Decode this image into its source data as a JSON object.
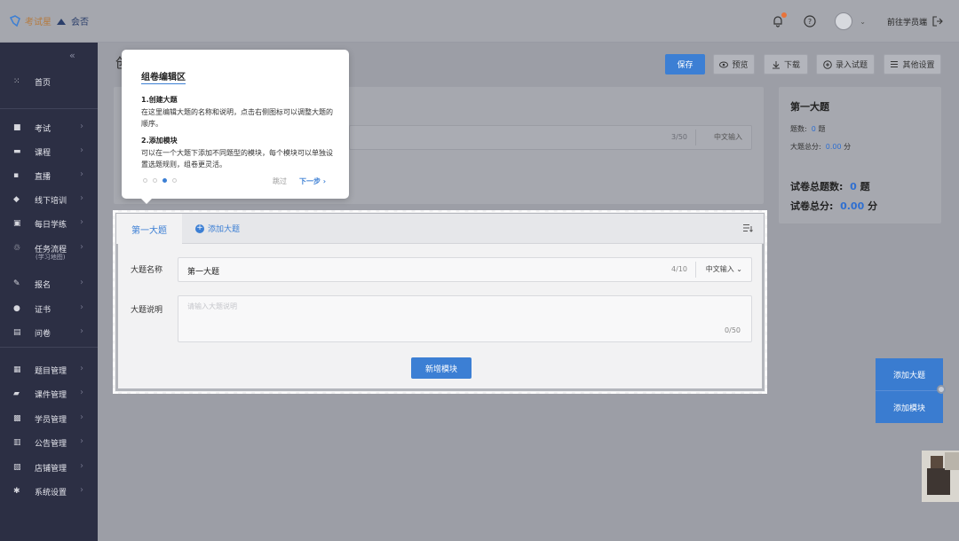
{
  "brand": {
    "logo_text": "考试星",
    "sub_brand": "会否",
    "accent": "#3c7fd4"
  },
  "header": {
    "goto_student": "前往学员端"
  },
  "sidebar": {
    "items": [
      {
        "label": "首页",
        "icon": "grid-icon",
        "arrow": false
      },
      {
        "label": "考试",
        "icon": "exam-icon",
        "arrow": true
      },
      {
        "label": "课程",
        "icon": "book-icon",
        "arrow": true
      },
      {
        "label": "直播",
        "icon": "live-icon",
        "arrow": true
      },
      {
        "label": "线下培训",
        "icon": "training-icon",
        "arrow": true
      },
      {
        "label": "每日学练",
        "icon": "calendar-icon",
        "arrow": true
      },
      {
        "label": "任务流程",
        "sub": "(学习地图)",
        "icon": "flow-icon",
        "arrow": true
      },
      {
        "label": "报名",
        "icon": "signup-icon",
        "arrow": true
      },
      {
        "label": "证书",
        "icon": "certificate-icon",
        "arrow": true
      },
      {
        "label": "问卷",
        "icon": "survey-icon",
        "arrow": true
      },
      {
        "label": "题目管理",
        "icon": "question-icon",
        "arrow": true
      },
      {
        "label": "课件管理",
        "icon": "folder-icon",
        "arrow": true
      },
      {
        "label": "学员管理",
        "icon": "user-icon",
        "arrow": true
      },
      {
        "label": "公告管理",
        "icon": "notice-icon",
        "arrow": true
      },
      {
        "label": "店铺管理",
        "icon": "shop-icon",
        "arrow": true
      },
      {
        "label": "系统设置",
        "icon": "gear-icon",
        "arrow": true
      }
    ]
  },
  "page": {
    "title_partial": "创"
  },
  "toolbar": {
    "save": "保存",
    "preview": "预览",
    "download": "下载",
    "import": "录入试题",
    "other": "其他设置"
  },
  "name_input": {
    "count": "3/50",
    "ime": "中文输入"
  },
  "tooltip": {
    "title": "组卷编辑区",
    "step1_title": "1.创建大题",
    "step1_text": "在这里编辑大题的名称和说明，点击右侧图标可以调整大题的顺序。",
    "step2_title": "2.添加模块",
    "step2_text": "可以在一个大题下添加不同题型的模块，每个模块可以单独设置选题规则，组卷更灵活。",
    "skip": "跳过",
    "next": "下一步"
  },
  "editor": {
    "tab_active": "第一大题",
    "tab_add": "添加大题",
    "name_label": "大题名称",
    "name_value": "第一大题",
    "name_count": "4/10",
    "name_ime": "中文输入",
    "desc_label": "大题说明",
    "desc_placeholder": "请输入大题说明",
    "desc_count": "0/50",
    "add_module": "新增模块"
  },
  "summary": {
    "title": "第一大题",
    "count_label": "题数:",
    "count_value": "0",
    "count_unit": "题",
    "score_label": "大题总分:",
    "score_value": "0.00",
    "score_unit": "分",
    "total_count_label": "试卷总题数:",
    "total_count_value": "0",
    "total_count_unit": "题",
    "total_score_label": "试卷总分:",
    "total_score_value": "0.00",
    "total_score_unit": "分"
  },
  "float_actions": {
    "add_section": "添加大题",
    "add_module": "添加模块"
  }
}
